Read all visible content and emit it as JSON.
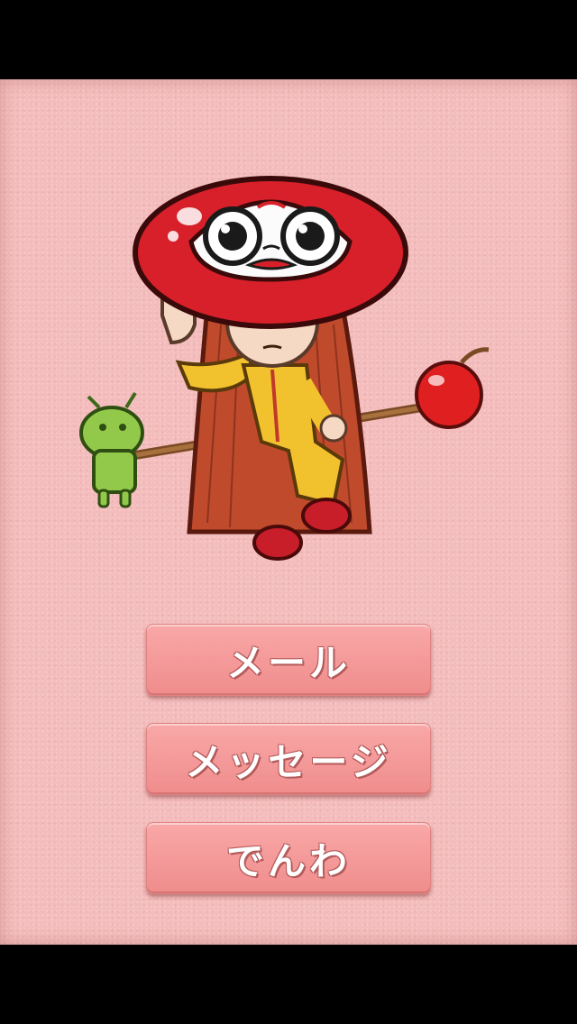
{
  "menu": {
    "mail_label": "メール",
    "message_label": "メッセージ",
    "phone_label": "でんわ"
  },
  "colors": {
    "background": "#f4bcbc",
    "button": "#f49a9a",
    "button_text": "#ffffff",
    "daruma_red": "#d8202a",
    "hair": "#b8452a",
    "suit": "#f2c12e",
    "android_green": "#8cc63f"
  },
  "icons": {
    "mascot": "daruma-girl-character"
  }
}
